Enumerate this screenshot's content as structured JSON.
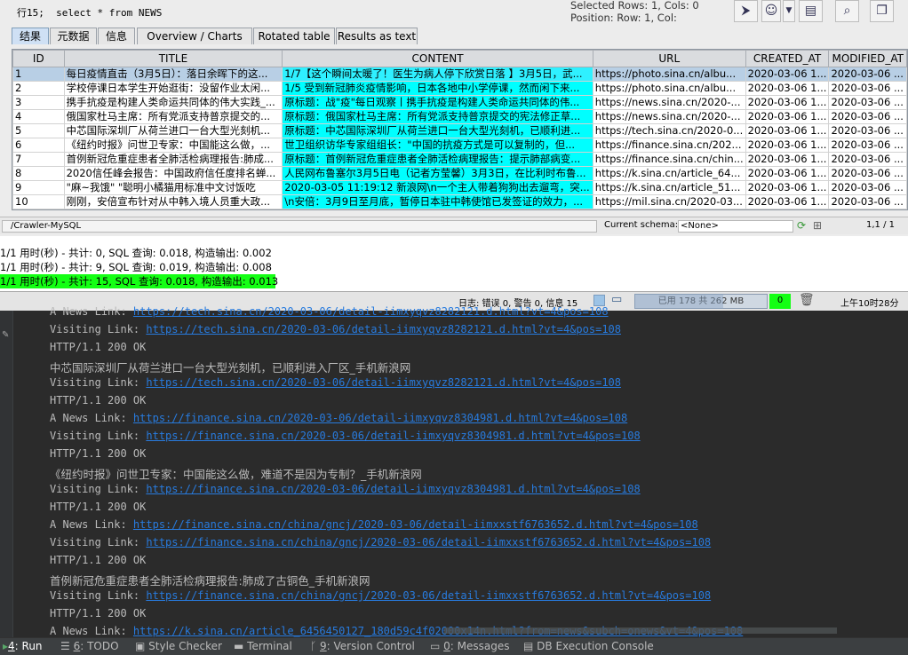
{
  "query": {
    "line_label": "行15;",
    "sql": "select * from NEWS"
  },
  "selection": {
    "rows_cols": "Selected Rows: 1, Cols: 0",
    "position": "Position: Row: 1, Col:"
  },
  "toolbar_icons": [
    "run-icon",
    "users-icon",
    "dropdown-icon",
    "export-icon",
    "search-icon",
    "copy-icon"
  ],
  "tabs": [
    "结果",
    "元数据",
    "信息",
    "Overview / Charts",
    "Rotated table",
    "Results as text"
  ],
  "columns": [
    "ID",
    "TITLE",
    "CONTENT",
    "URL",
    "CREATED_AT",
    "MODIFIED_AT"
  ],
  "rows": [
    {
      "id": "1",
      "title": "每日疫情直击（3月5日）：落日余晖下的这...",
      "content": "1/7【这个瞬间太暖了！医生为病人停下欣赏日落 】3月5日，武...",
      "url": "https://photo.sina.cn/albu...",
      "created": "2020-03-06 1...",
      "modified": "2020-03-06 ..."
    },
    {
      "id": "2",
      "title": "学校停课日本学生开始逛街：没留作业太闲...",
      "content": "1/5 受到新冠肺炎疫情影响，日本各地中小学停课，然而闲下来...",
      "url": "https://photo.sina.cn/albu...",
      "created": "2020-03-06 1...",
      "modified": "2020-03-06 ..."
    },
    {
      "id": "3",
      "title": "携手抗疫是构建人类命运共同体的伟大实践_...",
      "content": "原标题：战\"疫\"每日观察丨携手抗疫是构建人类命运共同体的伟...",
      "url": "https://news.sina.cn/2020-...",
      "created": "2020-03-06 1...",
      "modified": "2020-03-06 ..."
    },
    {
      "id": "4",
      "title": "俄国家杜马主席：所有党派支持普京提交的...",
      "content": "原标题：俄国家杜马主席：所有党派支持普京提交的宪法修正草...",
      "url": "https://news.sina.cn/2020-...",
      "created": "2020-03-06 1...",
      "modified": "2020-03-06 ..."
    },
    {
      "id": "5",
      "title": "中芯国际深圳厂从荷兰进口一台大型光刻机...",
      "content": "原标题：中芯国际深圳厂从荷兰进口一台大型光刻机，已顺利进...",
      "url": "https://tech.sina.cn/2020-0...",
      "created": "2020-03-06 1...",
      "modified": "2020-03-06 ..."
    },
    {
      "id": "6",
      "title": "《纽约时报》问世卫专家：中国能这么做，...",
      "content": "世卫组织访华专家组组长：\"中国的抗疫方式是可以复制的，但...",
      "url": "https://finance.sina.cn/202...",
      "created": "2020-03-06 1...",
      "modified": "2020-03-06 ..."
    },
    {
      "id": "7",
      "title": "首例新冠危重症患者全肺活检病理报告:肺成...",
      "content": "原标题：首例新冠危重症患者全肺活检病理报告：提示肺部病变...",
      "url": "https://finance.sina.cn/chin...",
      "created": "2020-03-06 1...",
      "modified": "2020-03-06 ..."
    },
    {
      "id": "8",
      "title": "2020信任峰会报告：中国政府信任度排名蝉...",
      "content": "人民网布鲁塞尔3月5日电（记者方莹馨）3月3日，在比利时布鲁...",
      "url": "https://k.sina.cn/article_64...",
      "created": "2020-03-06 1...",
      "modified": "2020-03-06 ..."
    },
    {
      "id": "9",
      "title": "\"麻~我饿\" \"聪明小橘猫用标准中文讨饭吃",
      "content": "2020-03-05 11:19:12 新浪网\\n一个主人带着狗狗出去遛弯，突...",
      "url": "https://k.sina.cn/article_51...",
      "created": "2020-03-06 1...",
      "modified": "2020-03-06 ..."
    },
    {
      "id": "10",
      "title": "刚刚，安倍宣布针对从中韩入境人员重大政...",
      "content": "\\n安倍：3月9日至月底，暂停日本驻中韩使馆已发签证的效力，...",
      "url": "https://mil.sina.cn/2020-03...",
      "created": "2020-03-06 1...",
      "modified": "2020-03-06 ..."
    }
  ],
  "status": {
    "path": "/Crawler-MySQL",
    "schema_label": "Current schema:",
    "schema_value": "<None>",
    "count": "1,1 / 1"
  },
  "log_lines": [
    "1/1 用时(秒) - 共计: 0, SQL 查询: 0.018, 构造输出: 0.002",
    "1/1 用时(秒) - 共计: 9, SQL 查询: 0.019, 构造输出: 0.008",
    "1/1 用时(秒) - 共计: 15, SQL 查询: 0.018, 构造输出: 0.013"
  ],
  "status2": {
    "log_info": "日志: 错误 0, 警告 0, 信息 15",
    "memory": "已用 178 共 262 MB",
    "zero": "0",
    "time": "上午10时28分"
  },
  "console": [
    {
      "prefix": "A News Link: ",
      "url": "https://tech.sina.cn/2020-03-06/detail-iimxyqvz8282121.d.html?vt=4&pos=108",
      "partial": true
    },
    {
      "prefix": "Visiting Link: ",
      "url": "https://tech.sina.cn/2020-03-06/detail-iimxyqvz8282121.d.html?vt=4&pos=108"
    },
    {
      "text": "HTTP/1.1 200 OK"
    },
    {
      "cn": "中芯国际深圳厂从荷兰进口一台大型光刻机，已顺利进入厂区_手机新浪网"
    },
    {
      "prefix": "Visiting Link: ",
      "url": "https://tech.sina.cn/2020-03-06/detail-iimxyqvz8282121.d.html?vt=4&pos=108"
    },
    {
      "text": "HTTP/1.1 200 OK"
    },
    {
      "prefix": "A News Link: ",
      "url": "https://finance.sina.cn/2020-03-06/detail-iimxyqvz8304981.d.html?vt=4&pos=108"
    },
    {
      "prefix": "Visiting Link: ",
      "url": "https://finance.sina.cn/2020-03-06/detail-iimxyqvz8304981.d.html?vt=4&pos=108"
    },
    {
      "text": "HTTP/1.1 200 OK"
    },
    {
      "cn": "《纽约时报》问世卫专家：中国能这么做，难道不是因为专制？_手机新浪网"
    },
    {
      "prefix": "Visiting Link: ",
      "url": "https://finance.sina.cn/2020-03-06/detail-iimxyqvz8304981.d.html?vt=4&pos=108"
    },
    {
      "text": "HTTP/1.1 200 OK"
    },
    {
      "prefix": "A News Link: ",
      "url": "https://finance.sina.cn/china/gncj/2020-03-06/detail-iimxxstf6763652.d.html?vt=4&pos=108"
    },
    {
      "prefix": "Visiting Link: ",
      "url": "https://finance.sina.cn/china/gncj/2020-03-06/detail-iimxxstf6763652.d.html?vt=4&pos=108"
    },
    {
      "text": "HTTP/1.1 200 OK"
    },
    {
      "cn": "首例新冠危重症患者全肺活检病理报告:肺成了古铜色_手机新浪网"
    },
    {
      "prefix": "Visiting Link: ",
      "url": "https://finance.sina.cn/china/gncj/2020-03-06/detail-iimxxstf6763652.d.html?vt=4&pos=108"
    },
    {
      "text": "HTTP/1.1 200 OK"
    },
    {
      "prefix": "A News Link: ",
      "url": "https://k.sina.cn/article_6456450127_180d59c4f02000x14n.html?from=news&subch=onews&vt=4&pos=108"
    }
  ],
  "bottom_tabs": [
    {
      "num": "4",
      "label": ": Run"
    },
    {
      "num": "6",
      "label": ": TODO"
    },
    {
      "num": "",
      "label": "Style Checker"
    },
    {
      "num": "",
      "label": "Terminal"
    },
    {
      "num": "9",
      "label": ": Version Control"
    },
    {
      "num": "0",
      "label": ": Messages"
    },
    {
      "num": "",
      "label": "DB Execution Console"
    }
  ],
  "colors": {
    "content_cell": "#00ffff",
    "selected_row": "#b8cfe5",
    "log_highlight": "#14ff14",
    "link": "#287bde",
    "console_bg": "#2b2b2b"
  }
}
